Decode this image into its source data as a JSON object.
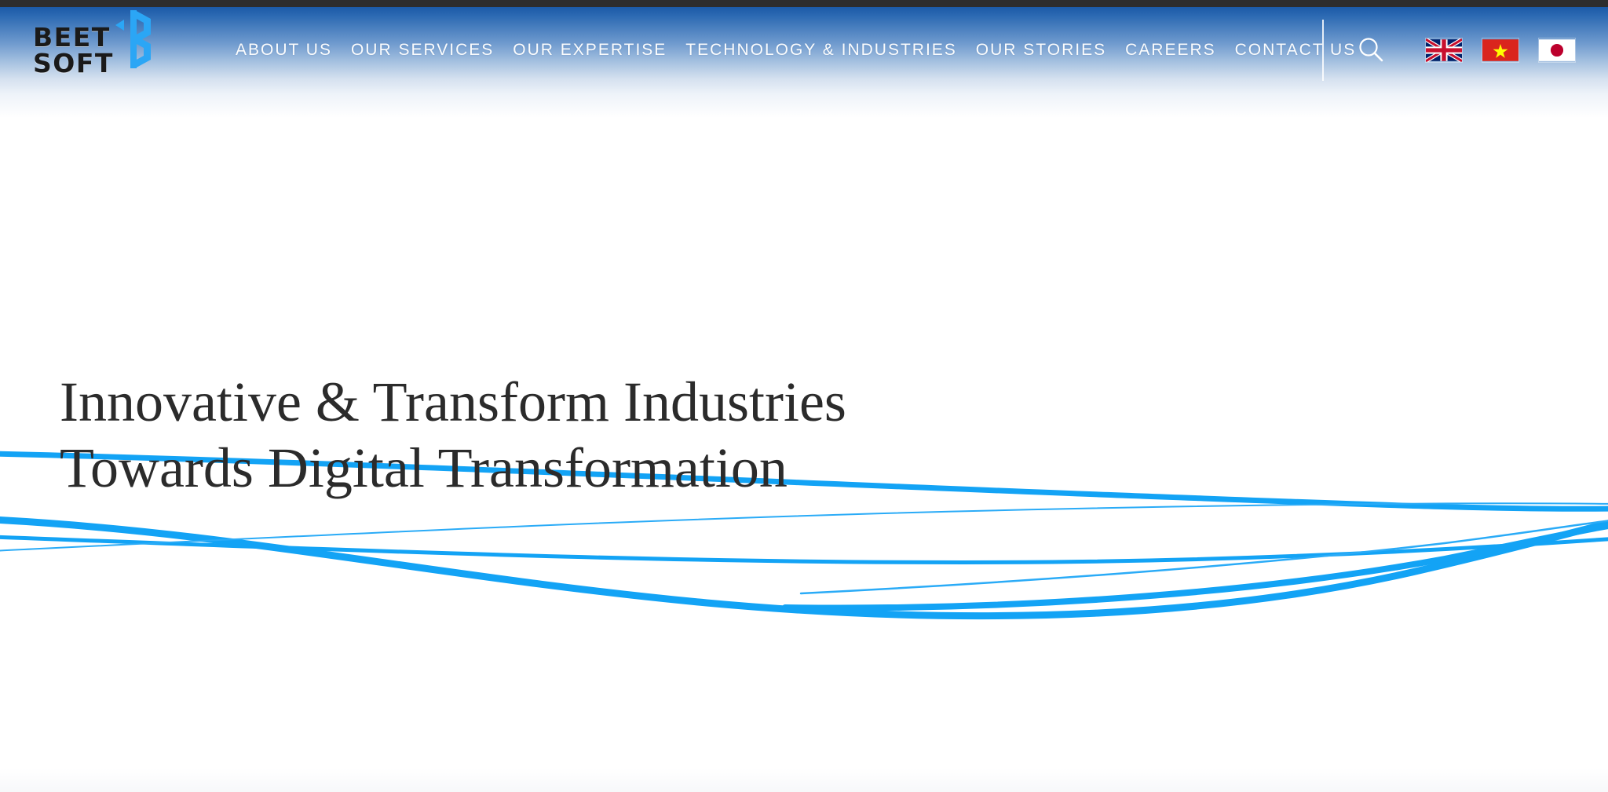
{
  "site": {
    "brand": {
      "line1": "BEET",
      "line2": "SOFT",
      "mark_icon": "beetsoft-b-hexagon-logo-icon",
      "mark_color": "#2ba6f5"
    },
    "theme": {
      "header_top_strip": "#2d2d2d",
      "header_blue": "#1b5aa8",
      "nav_text": "#ffffff",
      "wave_blue": "#13a3f5",
      "heading_text": "#2b2b2b",
      "page_background": "#ffffff"
    }
  },
  "header": {
    "nav": [
      {
        "label": "ABOUT US",
        "name": "nav-about-us"
      },
      {
        "label": "OUR SERVICES",
        "name": "nav-our-services"
      },
      {
        "label": "OUR EXPERTISE",
        "name": "nav-our-expertise"
      },
      {
        "label": "TECHNOLOGY & INDUSTRIES",
        "name": "nav-technology-industries"
      },
      {
        "label": "OUR STORIES",
        "name": "nav-our-stories"
      },
      {
        "label": "CAREERS",
        "name": "nav-careers"
      },
      {
        "label": "CONTACT US",
        "name": "nav-contact-us"
      }
    ],
    "search": {
      "icon": "search-icon",
      "label": "Search"
    },
    "languages": [
      {
        "code": "en",
        "label": "English",
        "icon": "flag-united-kingdom-icon"
      },
      {
        "code": "vi",
        "label": "Vietnamese",
        "icon": "flag-vietnam-icon"
      },
      {
        "code": "ja",
        "label": "Japanese",
        "icon": "flag-japan-icon"
      }
    ]
  },
  "hero": {
    "heading_line1": "Innovative & Transform Industries",
    "heading_line2": "Towards Digital Transformation"
  }
}
